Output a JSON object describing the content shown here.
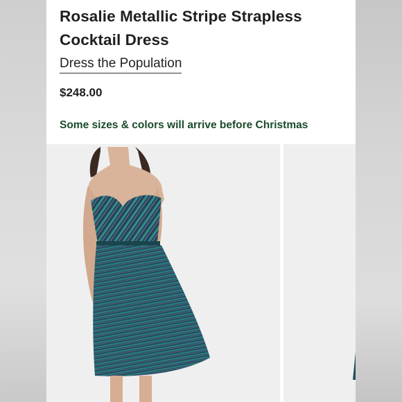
{
  "product": {
    "title": "Rosalie Metallic Stripe Strapless Cocktail Dress",
    "brand": "Dress the Population",
    "price": "$248.00",
    "shipping_notice": "Some sizes & colors will arrive before Christmas"
  },
  "colors": {
    "notice_green": "#1b4a2b",
    "dress_teal": "#1f5a60",
    "photo_bg": "#efefef"
  }
}
